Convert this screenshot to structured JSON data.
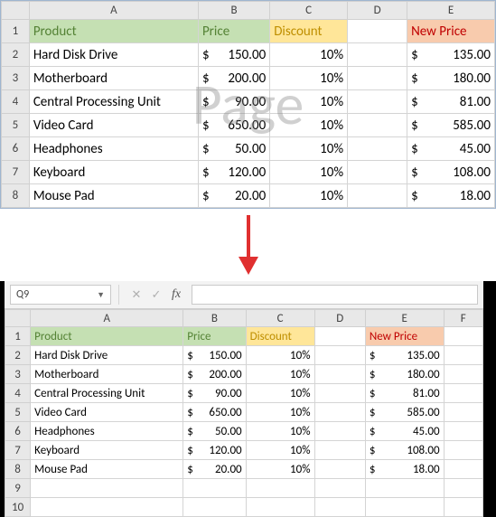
{
  "watermark": "Page",
  "columns": [
    "A",
    "B",
    "C",
    "D",
    "E"
  ],
  "columns_bottom": [
    "A",
    "B",
    "C",
    "D",
    "E",
    "F"
  ],
  "headers": {
    "product": "Product",
    "price": "Price",
    "discount": "Discount",
    "newprice": "New Price"
  },
  "rows": [
    {
      "n": "1"
    },
    {
      "n": "2",
      "product": "Hard Disk Drive",
      "price": "150.00",
      "discount": "10%",
      "newprice": "135.00"
    },
    {
      "n": "3",
      "product": "Motherboard",
      "price": "200.00",
      "discount": "10%",
      "newprice": "180.00"
    },
    {
      "n": "4",
      "product": "Central Processing Unit",
      "price": "90.00",
      "discount": "10%",
      "newprice": "81.00"
    },
    {
      "n": "5",
      "product": "Video Card",
      "price": "650.00",
      "discount": "10%",
      "newprice": "585.00"
    },
    {
      "n": "6",
      "product": "Headphones",
      "price": "50.00",
      "discount": "10%",
      "newprice": "45.00"
    },
    {
      "n": "7",
      "product": "Keyboard",
      "price": "120.00",
      "discount": "10%",
      "newprice": "108.00"
    },
    {
      "n": "8",
      "product": "Mouse Pad",
      "price": "20.00",
      "discount": "10%",
      "newprice": "18.00"
    }
  ],
  "extra_bottom_rows": [
    "9",
    "10"
  ],
  "namebox": "Q9",
  "currency": "$",
  "fx_label": "fx",
  "chart_data": {
    "type": "table",
    "title": "Product price discount table",
    "columns": [
      "Product",
      "Price",
      "Discount",
      "New Price"
    ],
    "data": [
      [
        "Hard Disk Drive",
        150.0,
        0.1,
        135.0
      ],
      [
        "Motherboard",
        200.0,
        0.1,
        180.0
      ],
      [
        "Central Processing Unit",
        90.0,
        0.1,
        81.0
      ],
      [
        "Video Card",
        650.0,
        0.1,
        585.0
      ],
      [
        "Headphones",
        50.0,
        0.1,
        45.0
      ],
      [
        "Keyboard",
        120.0,
        0.1,
        108.0
      ],
      [
        "Mouse Pad",
        20.0,
        0.1,
        18.0
      ]
    ]
  }
}
